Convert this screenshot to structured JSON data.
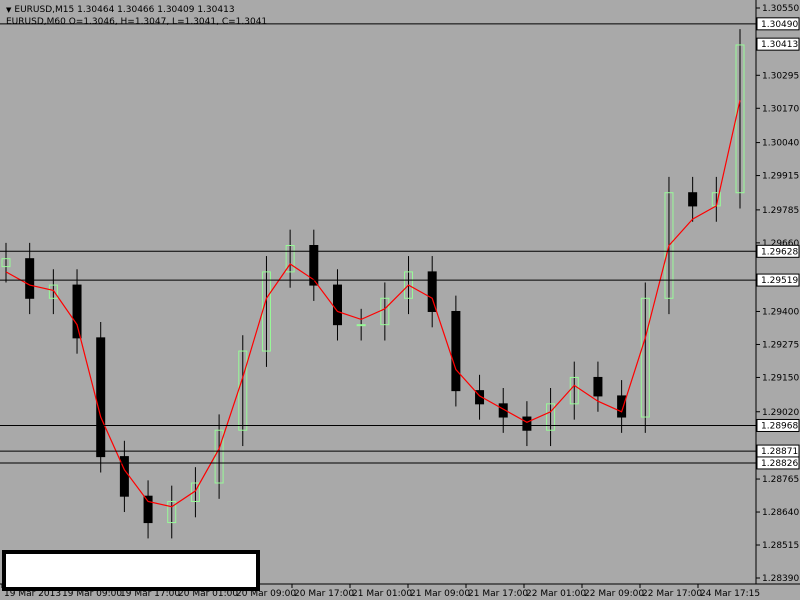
{
  "header": {
    "line1": "EURUSD,M15  1.30464 1.30466 1.30409 1.30413",
    "line2": "EURUSD,M60  O=1.3046,  H=1.3047,  L=1.3041,  C=1.3041",
    "dropdown_icon": "triangle-down-icon"
  },
  "colors": {
    "background": "#a9a9a9",
    "bull_candle": "#98fb98",
    "bear_candle": "#000000",
    "ma_line": "#ff0000",
    "hlines": "#000000",
    "price_tag_bg": "#ffffff",
    "mt4_blue": "#0000ff"
  },
  "chart_data": {
    "type": "candlestick",
    "symbol": "EURUSD",
    "timeframe": "M15",
    "y_axis_ticks": [
      "1.30550",
      "1.30295",
      "1.30170",
      "1.30040",
      "1.29915",
      "1.29785",
      "1.29660",
      "1.29400",
      "1.29275",
      "1.29150",
      "1.29020",
      "1.28765",
      "1.28640",
      "1.28515",
      "1.28390"
    ],
    "x_axis_ticks": [
      "19 Mar 2013",
      "19 Mar 09:00",
      "19 Mar 17:00",
      "20 Mar 01:00",
      "20 Mar 09:00",
      "20 Mar 17:00",
      "21 Mar 01:00",
      "21 Mar 09:00",
      "21 Mar 17:00",
      "22 Mar 01:00",
      "22 Mar 09:00",
      "22 Mar 17:00",
      "24 Mar 17:15"
    ],
    "horizontal_lines": [
      {
        "price": "1.30490",
        "value": 1.3049
      },
      {
        "price": "1.29628",
        "value": 1.29628
      },
      {
        "price": "1.29519",
        "value": 1.29519
      },
      {
        "price": "1.28968",
        "value": 1.28968
      },
      {
        "price": "1.28871",
        "value": 1.28871
      },
      {
        "price": "1.28826",
        "value": 1.28826
      }
    ],
    "current_price": {
      "label": "1.30413",
      "value": 1.30413
    },
    "ylim": [
      1.2839,
      1.3055
    ],
    "x": [
      "19 Mar 2013",
      "19 Mar 03:00",
      "19 Mar 06:00",
      "19 Mar 09:00",
      "19 Mar 12:00",
      "19 Mar 15:00",
      "19 Mar 18:00",
      "19 Mar 21:00",
      "20 Mar 00:00",
      "20 Mar 03:00",
      "20 Mar 06:00",
      "20 Mar 09:00",
      "20 Mar 12:00",
      "20 Mar 15:00",
      "20 Mar 18:00",
      "20 Mar 21:00",
      "21 Mar 00:00",
      "21 Mar 03:00",
      "21 Mar 06:00",
      "21 Mar 09:00",
      "21 Mar 12:00",
      "21 Mar 15:00",
      "21 Mar 18:00",
      "21 Mar 21:00",
      "22 Mar 00:00",
      "22 Mar 03:00",
      "22 Mar 06:00",
      "22 Mar 09:00",
      "22 Mar 12:00",
      "22 Mar 15:00",
      "22 Mar 18:00",
      "24 Mar 17:15"
    ],
    "close": [
      1.296,
      1.2945,
      1.295,
      1.293,
      1.2885,
      1.287,
      1.286,
      1.2868,
      1.2875,
      1.2895,
      1.2925,
      1.2955,
      1.2965,
      1.295,
      1.2935,
      1.2935,
      1.2945,
      1.2955,
      1.294,
      1.291,
      1.2905,
      1.29,
      1.2895,
      1.2905,
      1.2915,
      1.2908,
      1.29,
      1.2945,
      1.2985,
      1.298,
      1.2985,
      1.3041
    ],
    "ma": [
      1.2955,
      1.295,
      1.2948,
      1.2935,
      1.29,
      1.288,
      1.2868,
      1.2866,
      1.2872,
      1.2888,
      1.2915,
      1.2945,
      1.2958,
      1.2952,
      1.294,
      1.2937,
      1.2941,
      1.295,
      1.2945,
      1.2918,
      1.2908,
      1.2903,
      1.2898,
      1.2902,
      1.2912,
      1.2906,
      1.2902,
      1.293,
      1.2965,
      1.2975,
      1.298,
      1.302
    ]
  }
}
